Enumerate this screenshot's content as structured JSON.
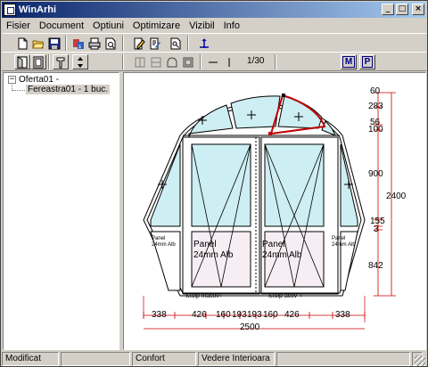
{
  "window": {
    "title": "WinArhi",
    "minimize": "_",
    "maximize": "□",
    "close": "×"
  },
  "menu": [
    "Fisier",
    "Document",
    "Optiuni",
    "Optimizare",
    "Vizibil",
    "Info"
  ],
  "toolbar1": {
    "icons": [
      "new-document-icon",
      "open-folder-icon",
      "save-icon",
      "calculator-icon",
      "print-icon",
      "print-preview-icon",
      "edit-document-icon",
      "edit-list-icon",
      "search-document-icon",
      "move-axes-icon"
    ]
  },
  "toolbar2": {
    "page_counter": "1/30",
    "view_m": "M",
    "view_p": "P"
  },
  "tree": {
    "root": "Oferta01 -",
    "child": "Fereastra01 - 1 buc."
  },
  "drawing": {
    "dims_right": [
      "60",
      "283",
      "56",
      "100",
      "900",
      "155",
      "3",
      "842"
    ],
    "dim_total_height": "2400",
    "dims_bottom": [
      "338",
      "426",
      "160",
      "193",
      "193",
      "160",
      "426",
      "338"
    ],
    "dim_total_width": "2500",
    "panel_left": [
      "Panel",
      "24mm Alb"
    ],
    "panel_right": [
      "Panel",
      "24mm Alb"
    ],
    "small_panel_left": [
      "Panel",
      "24mm Alb"
    ],
    "small_panel_right": [
      "Panel",
      "24mm Alb"
    ],
    "label_left_sash": "Stulp inactiv+",
    "label_right_sash": "Stulp activ +"
  },
  "status": [
    "Modificat",
    "",
    "Confort",
    "Vedere Interioara",
    "",
    ""
  ]
}
